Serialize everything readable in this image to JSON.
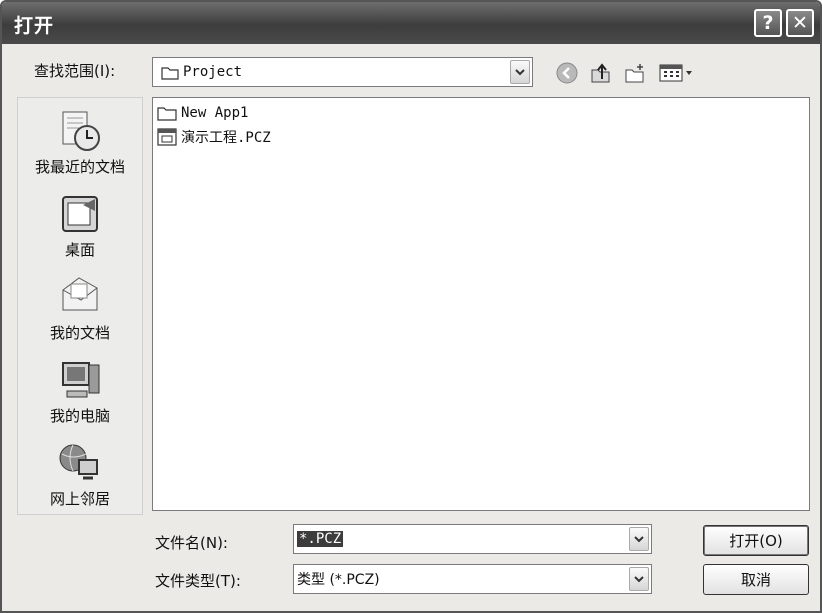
{
  "dialog": {
    "title": "打开"
  },
  "titlebar": {
    "help_label": "?",
    "close_label": "✕"
  },
  "look_in": {
    "label": "查找范围(I):",
    "value": "Project"
  },
  "toolbar": {
    "icons": [
      "back-icon",
      "up-folder-icon",
      "new-folder-icon",
      "view-menu-icon"
    ]
  },
  "places": [
    {
      "label": "我最近的文档",
      "icon": "recent-documents-icon"
    },
    {
      "label": "桌面",
      "icon": "desktop-icon"
    },
    {
      "label": "我的文档",
      "icon": "my-documents-icon"
    },
    {
      "label": "我的电脑",
      "icon": "my-computer-icon"
    },
    {
      "label": "网上邻居",
      "icon": "network-places-icon"
    }
  ],
  "files": [
    {
      "name": "New App1",
      "icon": "folder-icon"
    },
    {
      "name": "演示工程.PCZ",
      "icon": "project-file-icon"
    }
  ],
  "filename": {
    "label": "文件名(N):",
    "value": "*.PCZ"
  },
  "filetype": {
    "label": "文件类型(T):",
    "value": "类型 (*.PCZ)"
  },
  "buttons": {
    "open": "打开(O)",
    "cancel": "取消"
  }
}
